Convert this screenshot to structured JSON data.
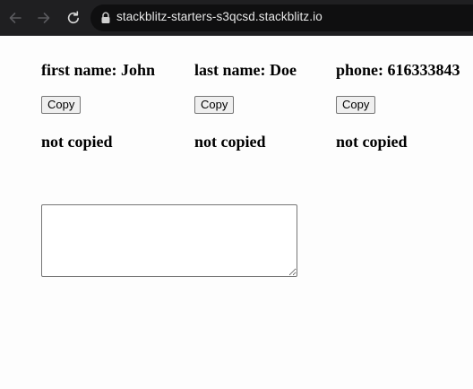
{
  "browser": {
    "url": "stackblitz-starters-s3qcsd.stackblitz.io",
    "icons": {
      "back": "arrow-left-icon",
      "forward": "arrow-right-icon",
      "reload": "reload-icon",
      "lock": "lock-icon"
    }
  },
  "fields": [
    {
      "label": "first name: John",
      "button": "Copy",
      "status": "not copied"
    },
    {
      "label": "last name: Doe",
      "button": "Copy",
      "status": "not copied"
    },
    {
      "label": "phone: 616333843",
      "button": "Copy",
      "status": "not copied"
    }
  ],
  "textarea": {
    "value": "",
    "placeholder": ""
  },
  "colors": {
    "browser_bar": "#1f1f21",
    "address_bar": "#0f0f10",
    "page_background": "#fdfdfd",
    "button_background": "#efefef"
  }
}
